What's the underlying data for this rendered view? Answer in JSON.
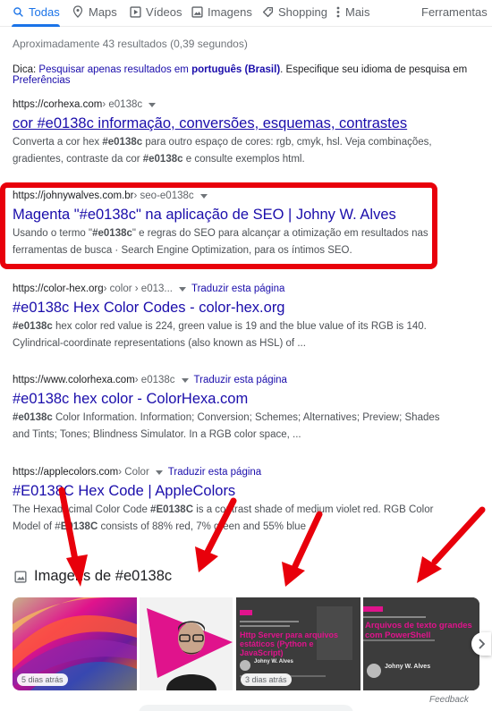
{
  "tabs": [
    {
      "label": "Todas",
      "icon": "search-icon",
      "active": true
    },
    {
      "label": "Maps",
      "icon": "map-pin-icon",
      "active": false
    },
    {
      "label": "Vídeos",
      "icon": "video-icon",
      "active": false
    },
    {
      "label": "Imagens",
      "icon": "image-icon",
      "active": false
    },
    {
      "label": "Shopping",
      "icon": "tag-icon",
      "active": false
    },
    {
      "label": "Mais",
      "icon": "more-icon",
      "active": false
    }
  ],
  "tools_label": "Ferramentas",
  "stats": "Aproximadamente 43 resultados (0,39 segundos)",
  "tip": {
    "prefix": "Dica: ",
    "link": "Pesquisar apenas resultados em",
    "lang": "português (Brasil)",
    "suffix": ". Especifique seu idioma de pesquisa em ",
    "prefs": "Preferências"
  },
  "results": [
    {
      "url": "https://corhexa.com",
      "crumb": " › e0138c",
      "translate": "",
      "title": "cor #e0138c informação, conversões, esquemas, contrastes",
      "snippet_html": "Converta a cor hex <b>#e0138c</b> para outro espaço de cores: rgb, cmyk, hsl. Veja combinações, gradientes, contraste da cor <b>#e0138c</b> e consulte exemplos html."
    },
    {
      "url": "https://johnywalves.com.br",
      "crumb": " › seo-e0138c",
      "translate": "",
      "title": "Magenta \"#e0138c\" na aplicação de SEO | Johny W. Alves",
      "snippet_html": "Usando o termo \"<b>#e0138c</b>\" e regras do SEO para alcançar a otimização em resultados nas ferramentas de busca · Search Engine Optimization, para os íntimos SEO."
    },
    {
      "url": "https://color-hex.org",
      "crumb": " › color › e013...",
      "translate": "Traduzir esta página",
      "title": "#e0138c Hex Color Codes - color-hex.org",
      "snippet_html": "<b>#e0138c</b> hex color red value is 224, green value is 19 and the blue value of its RGB is 140. Cylindrical-coordinate representations (also known as HSL) of ..."
    },
    {
      "url": "https://www.colorhexa.com",
      "crumb": " › e0138c",
      "translate": "Traduzir esta página",
      "title": "#e0138c hex color - ColorHexa.com",
      "snippet_html": "<b>#e0138c</b> Color Information. Information; Conversion; Schemes; Alternatives; Preview; Shades and Tints; Tones; Blindness Simulator. In a RGB color space, ..."
    },
    {
      "url": "https://applecolors.com",
      "crumb": " › Color",
      "translate": "Traduzir esta página",
      "title": "#E0138C Hex Code | AppleColors",
      "snippet_html": "The Hexadecimal Color Code <b>#E0138C</b> is a contrast shade of medium violet red. RGB Color Model of #<b>E0138C</b> consists of 88% red, 7% green and 55% blue ."
    }
  ],
  "images_heading": "Imagens de #e0138c",
  "thumbs": [
    {
      "badge": "5 dias atrás"
    },
    {
      "badge": ""
    },
    {
      "badge": "3 dias atrás",
      "title": "Http Server para arquivos estáticos (Python e JavaScript)",
      "author": "Johny W. Alves"
    },
    {
      "badge": "",
      "title": "Arquivos de texto grandes com PowerShell",
      "author": "Johny W. Alves"
    }
  ],
  "feedback": "Feedback",
  "colors": {
    "link": "#1a0dab",
    "active_tab": "#1a73e8",
    "annotation_red": "#e8000b",
    "magenta": "#e0138c"
  }
}
